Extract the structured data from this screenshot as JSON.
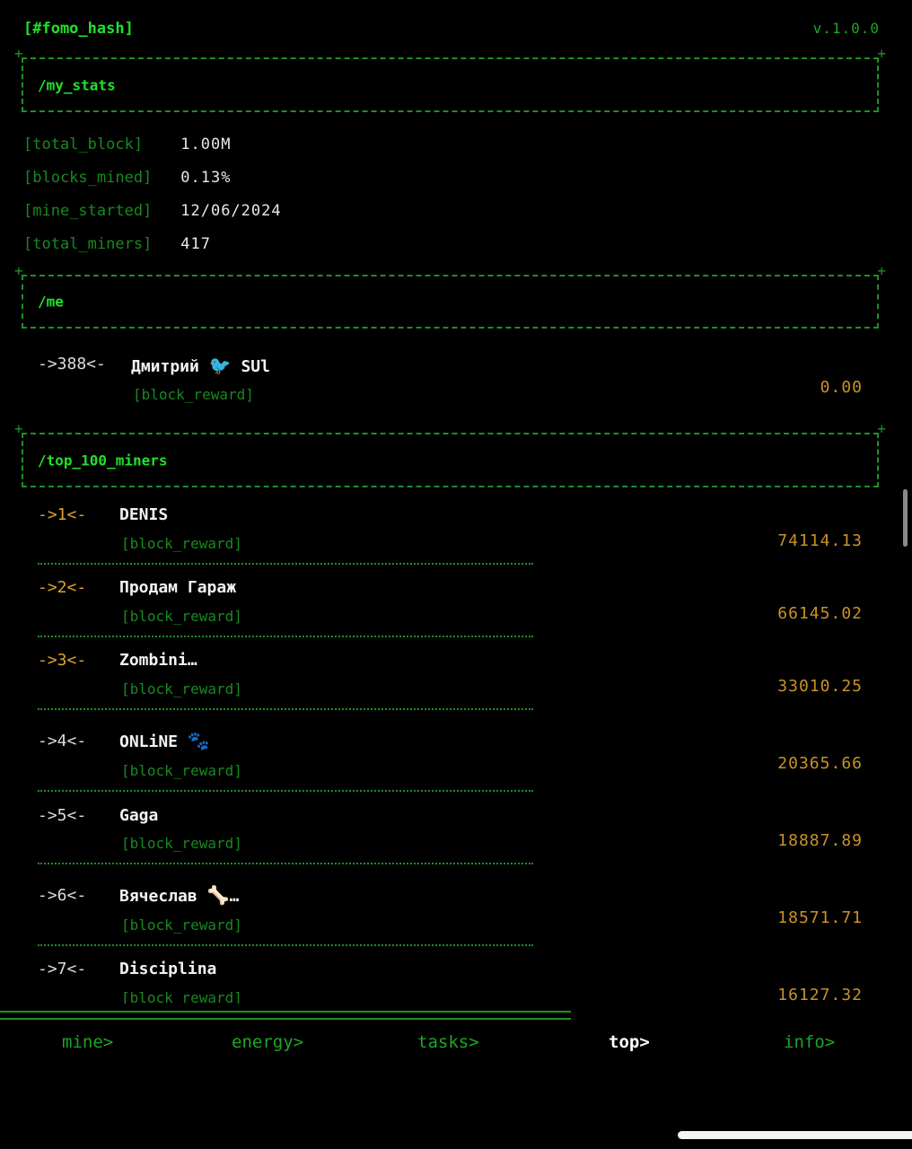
{
  "header": {
    "app_tag": "[#fomo_hash]",
    "version": "v.1.0.0"
  },
  "my_stats": {
    "title": "/my_stats",
    "rows": [
      {
        "label": "[total_block]",
        "value": "1.00M"
      },
      {
        "label": "[blocks_mined]",
        "value": "0.13%"
      },
      {
        "label": "[mine_started]",
        "value": "12/06/2024"
      },
      {
        "label": "[total_miners]",
        "value": "417"
      }
    ]
  },
  "me": {
    "title": "/me",
    "rank": "->388<-",
    "name": "Дмитрий",
    "emoji": "🐦",
    "name_suffix": "SUl",
    "reward_label": "[block_reward]",
    "reward_value": "0.00"
  },
  "top": {
    "title": "/top_100_miners",
    "reward_label": "[block_reward]",
    "miners": [
      {
        "rank": "->1<-",
        "name": "DENIS",
        "emoji": "",
        "suffix": "",
        "reward": "74114.13"
      },
      {
        "rank": "->2<-",
        "name": "Продам Гараж",
        "emoji": "",
        "suffix": "",
        "reward": "66145.02"
      },
      {
        "rank": "->3<-",
        "name": "Zombini…",
        "emoji": "",
        "suffix": "",
        "reward": "33010.25"
      },
      {
        "rank": "->4<-",
        "name": "ONLiNE",
        "emoji": "🐾",
        "suffix": "",
        "reward": "20365.66"
      },
      {
        "rank": "->5<-",
        "name": "Gaga",
        "emoji": "",
        "suffix": "",
        "reward": "18887.89"
      },
      {
        "rank": "->6<-",
        "name": "Вячеслав",
        "emoji": "🦴",
        "suffix": "…",
        "reward": "18571.71"
      },
      {
        "rank": "->7<-",
        "name": "Disciplina",
        "emoji": "",
        "suffix": "",
        "reward": "16127.32"
      }
    ]
  },
  "nav": {
    "items": [
      {
        "label": "mine>"
      },
      {
        "label": "energy>"
      },
      {
        "label": "tasks>"
      },
      {
        "label": "top>"
      },
      {
        "label": "info>"
      }
    ]
  },
  "colors": {
    "accent_green": "#22e02a",
    "dim_green": "#178a1f",
    "reward_gold": "#c89228",
    "top3_orange": "#e0a030"
  }
}
